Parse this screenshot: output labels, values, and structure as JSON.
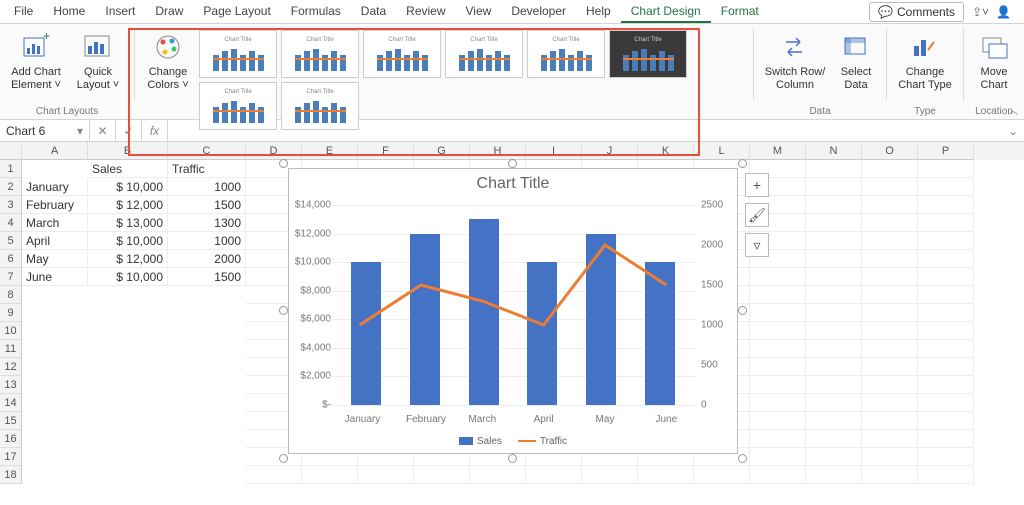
{
  "tabs": {
    "list": [
      "File",
      "Home",
      "Insert",
      "Draw",
      "Page Layout",
      "Formulas",
      "Data",
      "Review",
      "View",
      "Developer",
      "Help",
      "Chart Design",
      "Format"
    ],
    "active": "Chart Design"
  },
  "comments_btn": "Comments",
  "ribbon": {
    "chart_layouts": {
      "label": "Chart Layouts",
      "add_chart_element": "Add Chart Element ˅",
      "quick_layout": "Quick Layout ˅"
    },
    "change_colors": "Change Colors ˅",
    "styles": {
      "thumb_title": "Chart Title"
    },
    "data": {
      "label": "Data",
      "switch": "Switch Row/ Column",
      "select": "Select Data"
    },
    "type": {
      "label": "Type",
      "change": "Change Chart Type"
    },
    "location": {
      "label": "Location",
      "move": "Move Chart"
    }
  },
  "namebox": "Chart 6",
  "sheet": {
    "columns": [
      "A",
      "B",
      "C",
      "D",
      "E",
      "F",
      "G",
      "H",
      "I",
      "J",
      "K",
      "L",
      "M",
      "N",
      "O",
      "P"
    ],
    "headers": {
      "B": "Sales",
      "C": "Traffic"
    },
    "rows": [
      {
        "A": "January",
        "B": "$      10,000",
        "C": "1000"
      },
      {
        "A": "February",
        "B": "$      12,000",
        "C": "1500"
      },
      {
        "A": "March",
        "B": "$      13,000",
        "C": "1300"
      },
      {
        "A": "April",
        "B": "$      10,000",
        "C": "1000"
      },
      {
        "A": "May",
        "B": "$      12,000",
        "C": "2000"
      },
      {
        "A": "June",
        "B": "$      10,000",
        "C": "1500"
      }
    ]
  },
  "chart_data": {
    "type": "bar+line",
    "title": "Chart Title",
    "categories": [
      "January",
      "February",
      "March",
      "April",
      "May",
      "June"
    ],
    "series": [
      {
        "name": "Sales",
        "type": "bar",
        "axis": "left",
        "values": [
          10000,
          12000,
          13000,
          10000,
          12000,
          10000
        ]
      },
      {
        "name": "Traffic",
        "type": "line",
        "axis": "right",
        "values": [
          1000,
          1500,
          1300,
          1000,
          2000,
          1500
        ]
      }
    ],
    "y_left": {
      "ticks": [
        "$-",
        "$2,000",
        "$4,000",
        "$6,000",
        "$8,000",
        "$10,000",
        "$12,000",
        "$14,000"
      ],
      "min": 0,
      "max": 14000
    },
    "y_right": {
      "ticks": [
        "0",
        "500",
        "1000",
        "1500",
        "2000",
        "2500"
      ],
      "min": 0,
      "max": 2500
    },
    "legend": [
      "Sales",
      "Traffic"
    ],
    "colors": {
      "bar": "#4472c4",
      "line": "#ed7d31"
    }
  }
}
